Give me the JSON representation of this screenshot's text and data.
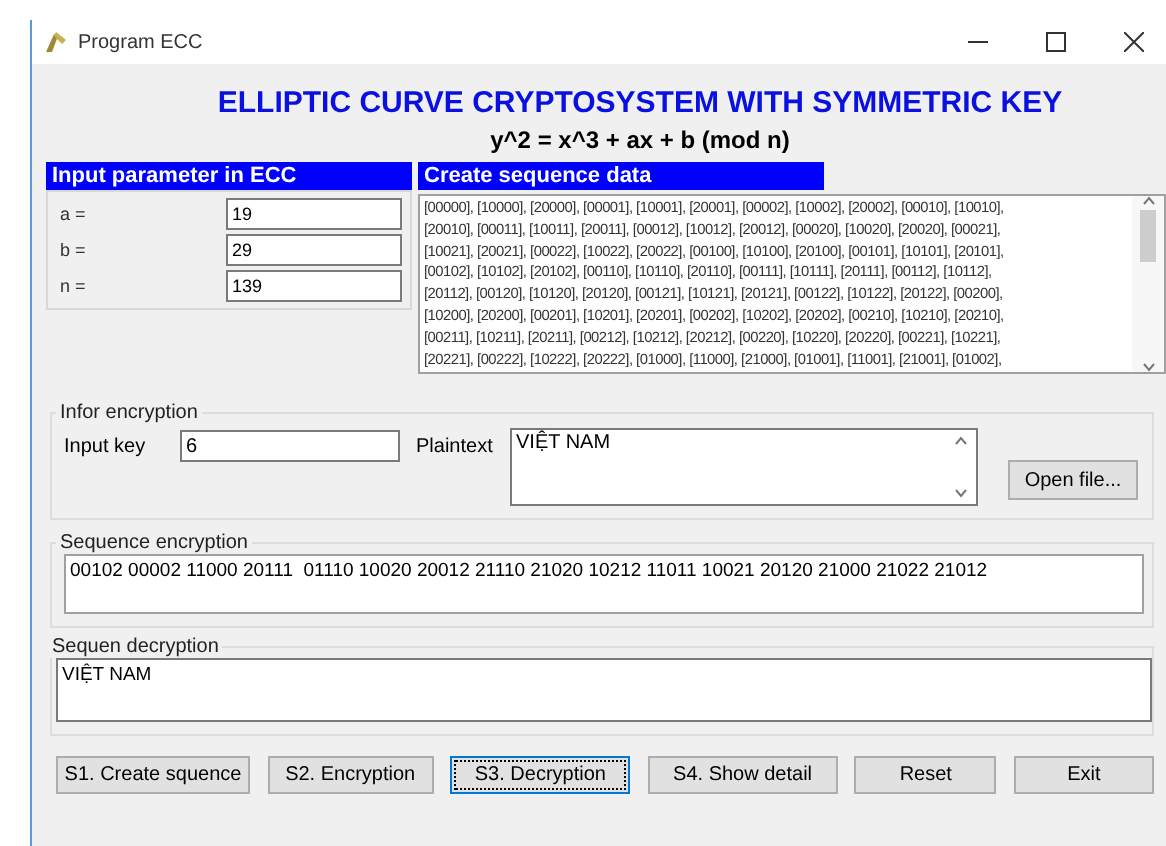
{
  "window": {
    "title": "Program ECC"
  },
  "heading": "ELLIPTIC CURVE CRYPTOSYSTEM WITH SYMMETRIC KEY",
  "formula": "y^2 = x^3 + ax + b (mod n)",
  "parameters": {
    "header": "Input parameter in ECC",
    "fields": [
      {
        "label": "a =",
        "value": "19"
      },
      {
        "label": "b =",
        "value": "29"
      },
      {
        "label": "n =",
        "value": "139"
      }
    ]
  },
  "sequence_data": {
    "header": "Create sequence data",
    "lines": [
      "[00000], [10000], [20000], [00001], [10001], [20001], [00002], [10002], [20002], [00010], [10010],",
      "[20010], [00011], [10011], [20011], [00012], [10012], [20012], [00020], [10020], [20020], [00021],",
      "[10021], [20021], [00022], [10022], [20022], [00100], [10100], [20100], [00101], [10101], [20101],",
      "[00102], [10102], [20102], [00110], [10110], [20110], [00111], [10111], [20111], [00112], [10112],",
      "[20112], [00120], [10120], [20120], [00121], [10121], [20121], [00122], [10122], [20122], [00200],",
      "[10200], [20200], [00201], [10201], [20201], [00202], [10202], [20202], [00210], [10210], [20210],",
      "[00211], [10211], [20211], [00212], [10212], [20212], [00220], [10220], [20220], [00221], [10221],",
      "[20221], [00222], [10222], [20222], [01000], [11000], [21000], [01001], [11001], [21001], [01002],"
    ]
  },
  "encryption_info": {
    "legend": "Infor encryption",
    "key_label": "Input key",
    "key_value": "6",
    "plaintext_label": "Plaintext",
    "plaintext_value": "VIỆT NAM",
    "open_button": "Open file..."
  },
  "sequence_encryption": {
    "legend": "Sequence encryption",
    "value": "00102 00002 11000 20111  01110 10020 20012 21110 21020 10212 11011 10021 20120 21000 21022 21012"
  },
  "sequence_decryption": {
    "legend": "Sequen decryption",
    "value": "VIỆT NAM"
  },
  "buttons": [
    {
      "label": "S1. Create squence",
      "focused": false
    },
    {
      "label": "S2. Encryption",
      "focused": false
    },
    {
      "label": "S3. Decryption",
      "focused": true
    },
    {
      "label": "S4. Show detail",
      "focused": false
    },
    {
      "label": "Reset",
      "focused": false
    },
    {
      "label": "Exit",
      "focused": false
    }
  ]
}
